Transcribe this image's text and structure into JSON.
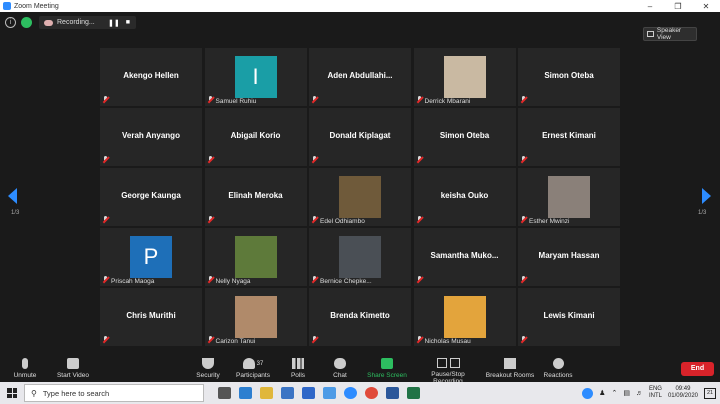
{
  "window": {
    "title": "Zoom Meeting",
    "controls": [
      "–",
      "❐",
      "✕"
    ]
  },
  "topbar": {
    "recording_label": "Recording...",
    "pause_glyph": "❚❚",
    "stop_glyph": "■",
    "speaker_view_label": "Speaker View"
  },
  "pagination": {
    "left": "1/3",
    "right": "1/3"
  },
  "participants": [
    {
      "name": "Akengo Hellen",
      "photo": "none"
    },
    {
      "name": "Samuel Ruhiu",
      "photo": "avatar",
      "initial": "I",
      "color": "#1a9ea6"
    },
    {
      "name": "Aden  Abdullahi...",
      "photo": "none"
    },
    {
      "name": "Derrick Mbarani",
      "photo": "photo",
      "color": "#c9b9a2"
    },
    {
      "name": "Simon Oteba",
      "photo": "none"
    },
    {
      "name": "Verah Anyango",
      "photo": "none"
    },
    {
      "name": "Abigail Korio",
      "photo": "none"
    },
    {
      "name": "Donald Kiplagat",
      "photo": "none"
    },
    {
      "name": "Simon Oteba",
      "photo": "none"
    },
    {
      "name": "Ernest Kimani",
      "photo": "none"
    },
    {
      "name": "George Kaunga",
      "photo": "none"
    },
    {
      "name": "Elinah Meroka",
      "photo": "none"
    },
    {
      "name": "Edel Odhiambo",
      "photo": "photo",
      "color": "#6f5a3a"
    },
    {
      "name": "keisha Ouko",
      "photo": "none"
    },
    {
      "name": "Esther Mwinzi",
      "photo": "photo",
      "color": "#8a8079"
    },
    {
      "name": "Priscah Maoga",
      "photo": "avatar",
      "initial": "P",
      "color": "#1e6fb8"
    },
    {
      "name": "Nelly Nyaga",
      "photo": "photo",
      "color": "#5e7a3a"
    },
    {
      "name": "Bernice Chepke...",
      "photo": "photo",
      "color": "#4a4f55"
    },
    {
      "name": "Samantha  Muko...",
      "photo": "none"
    },
    {
      "name": "Maryam Hassan",
      "photo": "none"
    },
    {
      "name": "Chris Murithi",
      "photo": "none"
    },
    {
      "name": "Carizon Tanui",
      "photo": "photo",
      "color": "#b08a6a"
    },
    {
      "name": "Brenda Kimetto",
      "photo": "none"
    },
    {
      "name": "Nicholas Musau",
      "photo": "photo",
      "color": "#e3a43c"
    },
    {
      "name": "Lewis Kimani",
      "photo": "none"
    }
  ],
  "controls": {
    "unmute": "Unmute",
    "start_video": "Start Video",
    "security": "Security",
    "participants": "Participants",
    "participants_count": "37",
    "polls": "Polls",
    "chat": "Chat",
    "share_screen": "Share Screen",
    "record": "Pause/Stop Recording",
    "breakout": "Breakout Rooms",
    "reactions": "Reactions",
    "end": "End"
  },
  "taskbar": {
    "search_placeholder": "Type here to search",
    "lang": "ENG",
    "layout": "INTL",
    "time": "09:49",
    "date": "01/09/2020",
    "notif_count": "21"
  },
  "colors": {
    "accent": "#2d8cff",
    "end": "#d8232a",
    "share": "#2dbe60",
    "mic_off": "#e02828"
  }
}
